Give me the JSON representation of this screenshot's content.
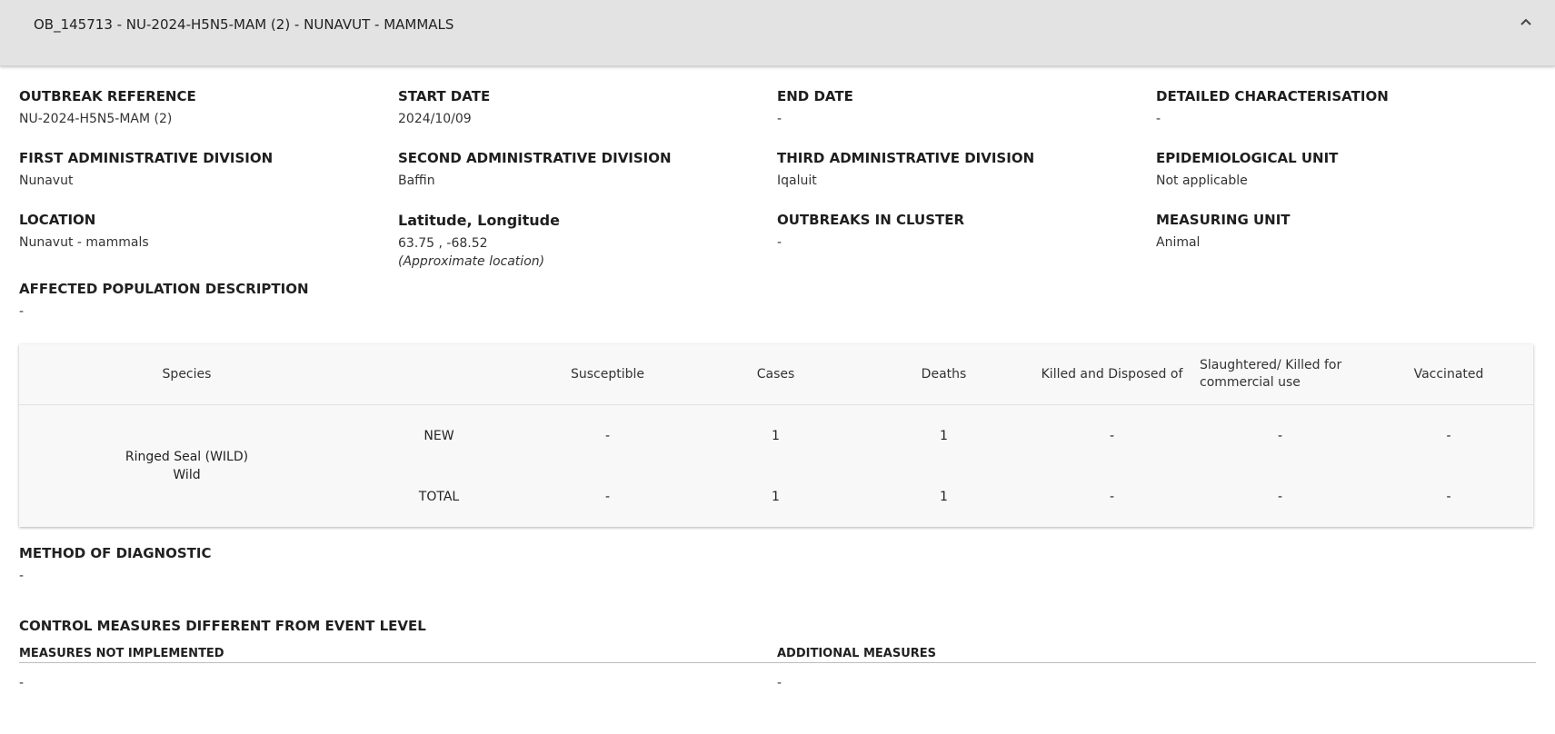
{
  "header": {
    "title": "OB_145713 - NU-2024-H5N5-MAM (2) - NUNAVUT - MAMMALS"
  },
  "fields": [
    {
      "label": "OUTBREAK REFERENCE",
      "value": "NU-2024-H5N5-MAM (2)"
    },
    {
      "label": "START DATE",
      "value": "2024/10/09"
    },
    {
      "label": "END DATE",
      "value": "-"
    },
    {
      "label": "DETAILED CHARACTERISATION",
      "value": "-"
    },
    {
      "label": "FIRST ADMINISTRATIVE DIVISION",
      "value": "Nunavut"
    },
    {
      "label": "SECOND ADMINISTRATIVE DIVISION",
      "value": "Baffin"
    },
    {
      "label": "THIRD ADMINISTRATIVE DIVISION",
      "value": "Iqaluit"
    },
    {
      "label": "EPIDEMIOLOGICAL UNIT",
      "value": "Not applicable"
    },
    {
      "label": "LOCATION",
      "value": "Nunavut - mammals"
    },
    {
      "label": "Latitude, Longitude",
      "value": "63.75 , -68.52",
      "note": "(Approximate location)"
    },
    {
      "label": "OUTBREAKS IN CLUSTER",
      "value": "-"
    },
    {
      "label": "MEASURING UNIT",
      "value": "Animal"
    }
  ],
  "affected_population": {
    "label": "AFFECTED POPULATION DESCRIPTION",
    "value": "-"
  },
  "table": {
    "headers": [
      "Species",
      "",
      "Susceptible",
      "Cases",
      "Deaths",
      "Killed and Disposed of",
      "Slaughtered/ Killed for commercial use",
      "Vaccinated"
    ],
    "species_name": "Ringed Seal (WILD)",
    "species_type": "Wild",
    "rows": [
      {
        "type": "NEW",
        "susceptible": "-",
        "cases": "1",
        "deaths": "1",
        "killed": "-",
        "slaughtered": "-",
        "vaccinated": "-"
      },
      {
        "type": "TOTAL",
        "susceptible": "-",
        "cases": "1",
        "deaths": "1",
        "killed": "-",
        "slaughtered": "-",
        "vaccinated": "-"
      }
    ]
  },
  "method_of_diagnostic": {
    "label": "METHOD OF DIAGNOSTIC",
    "value": "-"
  },
  "control_measures": {
    "title": "CONTROL MEASURES DIFFERENT FROM EVENT LEVEL",
    "not_implemented_label": "MEASURES NOT IMPLEMENTED",
    "not_implemented_value": "-",
    "additional_label": "ADDITIONAL MEASURES",
    "additional_value": "-"
  },
  "icons": {
    "collapse": "chevron-up-icon"
  }
}
